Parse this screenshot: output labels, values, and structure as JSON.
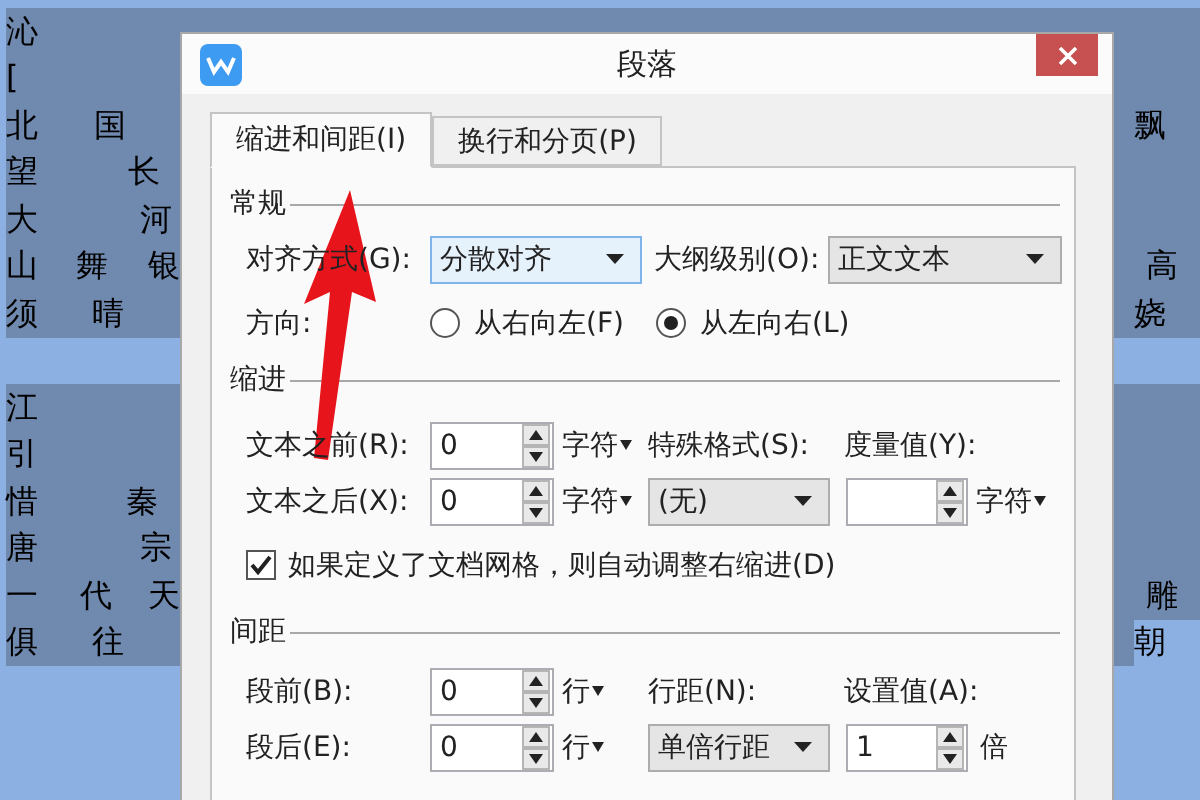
{
  "document": {
    "lines": [
      {
        "selected": true,
        "left": [
          "沁"
        ]
      },
      {
        "selected": true,
        "left": [
          "["
        ]
      },
      {
        "selected": true,
        "left": [
          "北",
          "国"
        ],
        "right": [
          {
            "text": "飘",
            "selected": true
          }
        ]
      },
      {
        "selected": true,
        "left": [
          "望",
          "长"
        ]
      },
      {
        "selected": true,
        "left": [
          "大",
          "河"
        ]
      },
      {
        "selected": true,
        "left": [
          "山",
          "舞",
          "银"
        ],
        "right": [
          {
            "text": "高",
            "selected": true
          }
        ]
      },
      {
        "selected": true,
        "left": [
          "须",
          "晴"
        ],
        "right": [
          {
            "text": "娆",
            "selected": true
          }
        ]
      },
      {
        "selected": false
      },
      {
        "selected": true,
        "left": [
          "江"
        ]
      },
      {
        "selected": true,
        "left": [
          "引"
        ]
      },
      {
        "selected": true,
        "left": [
          "惜",
          "秦"
        ]
      },
      {
        "selected": true,
        "left": [
          "唐",
          "宗"
        ]
      },
      {
        "selected": true,
        "left": [
          "一",
          "代",
          "天"
        ],
        "right": [
          {
            "text": "雕",
            "selected": true
          }
        ]
      },
      {
        "selected": true,
        "left": [
          "俱",
          "往"
        ],
        "right": [
          {
            "text": "朝",
            "selected": false
          }
        ]
      }
    ]
  },
  "dialog": {
    "title": "段落",
    "tabs": [
      {
        "label": "缩进和间距(I)",
        "selected": true
      },
      {
        "label": "换行和分页(P)",
        "selected": false
      }
    ],
    "general": {
      "heading": "常规",
      "alignment": {
        "label": "对齐方式(G):",
        "value": "分散对齐",
        "focused": true
      },
      "outline_level": {
        "label": "大纲级别(O):",
        "value": "正文文本",
        "focused": false
      },
      "direction": {
        "label": "方向:",
        "options": [
          {
            "label": "从右向左(F)",
            "selected": false
          },
          {
            "label": "从左向右(L)",
            "selected": true
          }
        ]
      }
    },
    "indent": {
      "heading": "缩进",
      "before": {
        "label": "文本之前(R):",
        "value": "0",
        "unit": "字符",
        "unit_menu": true
      },
      "after": {
        "label": "文本之后(X):",
        "value": "0",
        "unit": "字符",
        "unit_menu": true
      },
      "special": {
        "label": "特殊格式(S):",
        "value": "(无)",
        "focused": false
      },
      "measure": {
        "label": "度量值(Y):",
        "unit": "字符",
        "unit_menu": true
      },
      "auto_adjust": {
        "label": "如果定义了文档网格，则自动调整右缩进(D)",
        "checked": true
      }
    },
    "spacing": {
      "heading": "间距",
      "before": {
        "label": "段前(B):",
        "value": "0",
        "unit": "行",
        "unit_menu": true
      },
      "after": {
        "label": "段后(E):",
        "value": "0",
        "unit": "行",
        "unit_menu": true
      },
      "line_spacing": {
        "label": "行距(N):",
        "value": "单倍行距",
        "focused": false
      },
      "setting": {
        "label": "设置值(A):",
        "value": "1",
        "unit": "倍",
        "unit_menu": false
      }
    }
  },
  "annotation": {
    "kind": "arrow"
  }
}
